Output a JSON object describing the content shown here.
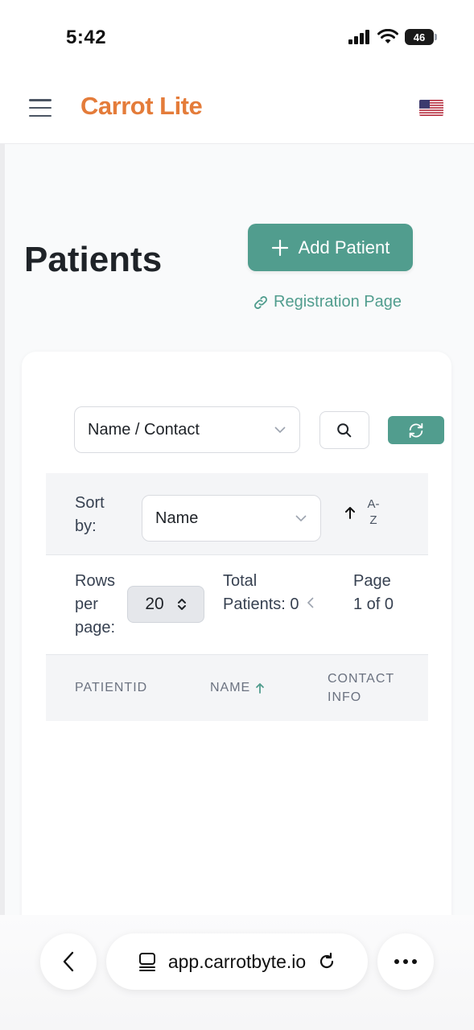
{
  "status_bar": {
    "time": "5:42",
    "battery": "46"
  },
  "header": {
    "brand": "Carrot Lite",
    "menu_icon": "hamburger-icon",
    "flag_icon": "us-flag-icon"
  },
  "page": {
    "title": "Patients",
    "add_button": "Add Patient",
    "registration_link": "Registration Page"
  },
  "search": {
    "field_value": "Name / Contact"
  },
  "sort": {
    "label": "Sort by:",
    "value": "Name",
    "direction": "A-Z"
  },
  "pagination": {
    "rows_label": "Rows per page:",
    "rows_value": "20",
    "total_label": "Total Patients: 0",
    "page_label": "Page 1 of 0"
  },
  "table": {
    "columns": [
      "PATIENTID",
      "NAME",
      "CONTACT INFO"
    ],
    "rows": []
  },
  "browser": {
    "url": "app.carrotbyte.io"
  },
  "colors": {
    "accent": "#519d8e",
    "brand": "#e47c3a"
  }
}
